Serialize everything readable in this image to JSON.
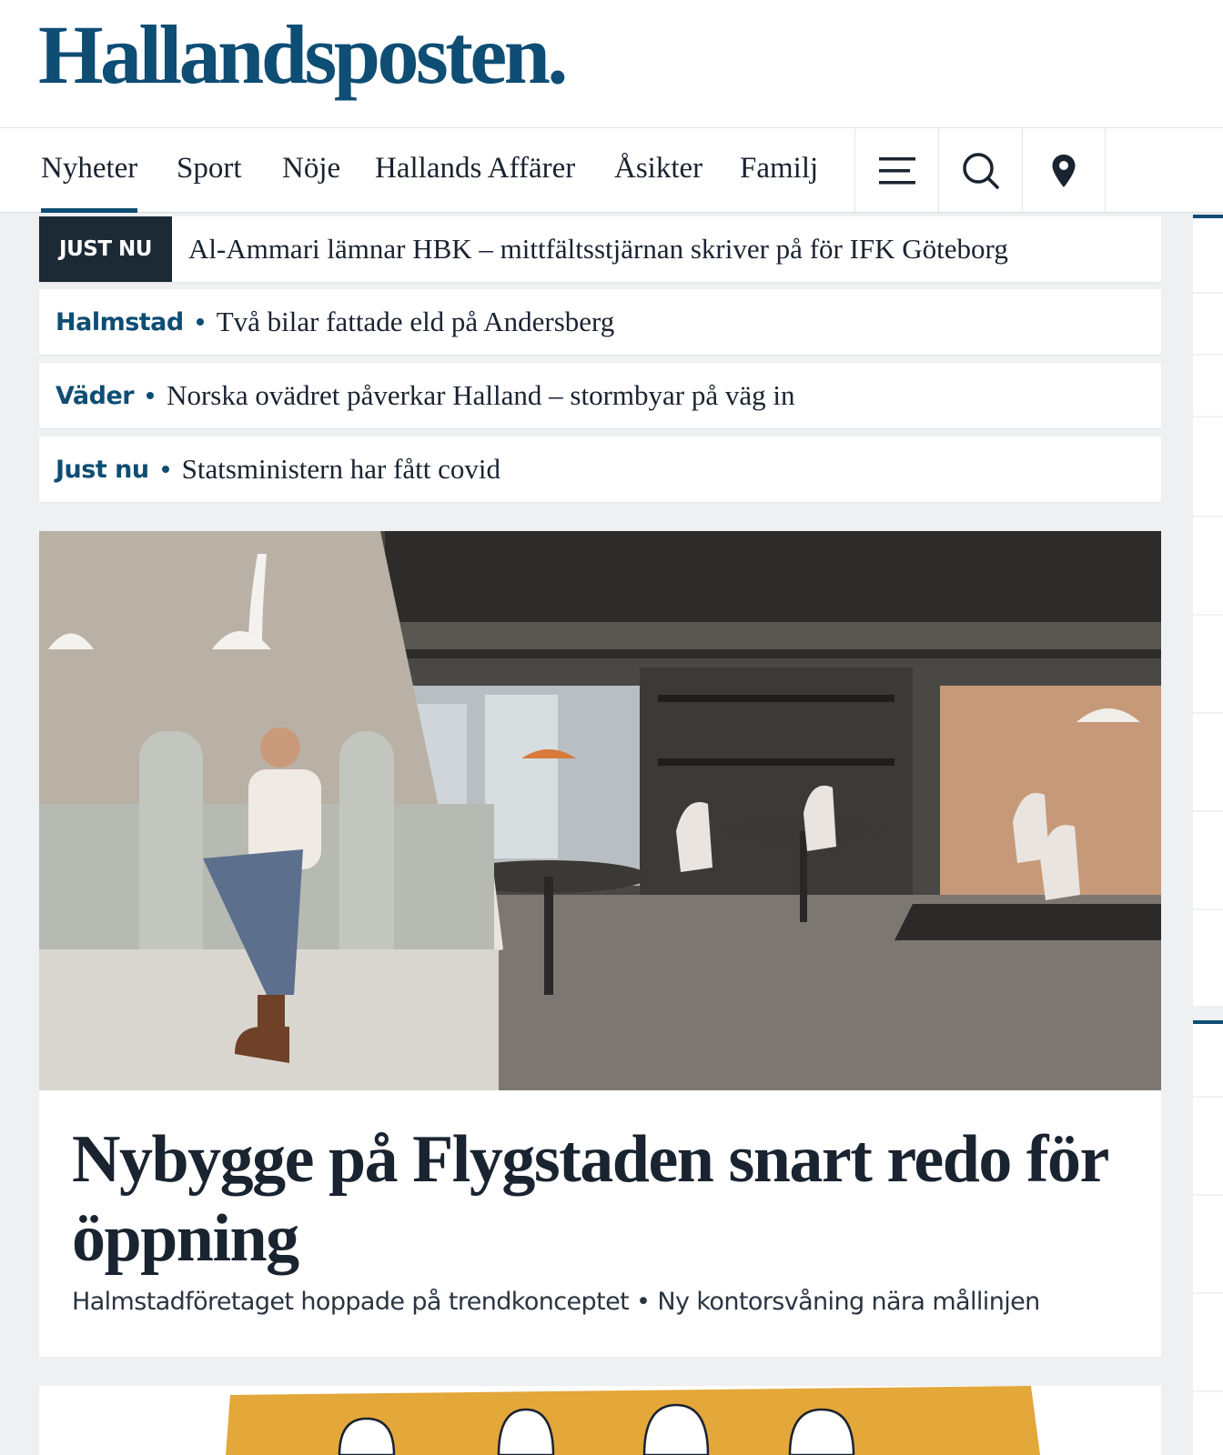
{
  "site": {
    "logo": "Hallandsposten."
  },
  "nav": {
    "items": [
      {
        "label": "Nyheter",
        "active": true
      },
      {
        "label": "Sport"
      },
      {
        "label": "Nöje"
      },
      {
        "label": "Hallands Affärer"
      },
      {
        "label": "Åsikter"
      },
      {
        "label": "Familj"
      }
    ],
    "icons": [
      "menu-icon",
      "search-icon",
      "location-pin-icon"
    ]
  },
  "breaking": {
    "badge": "JUST NU",
    "headline": "Al-Ammari lämnar HBK – mittfältsstjärnan skriver på för IFK Göteborg"
  },
  "news_items": [
    {
      "kicker": "Halmstad",
      "title": "Två bilar fattade eld på Andersberg"
    },
    {
      "kicker": "Väder",
      "title": "Norska ovädret påverkar Halland – stormbyar på väg in"
    },
    {
      "kicker": "Just nu",
      "title": "Statsministern har fått covid"
    }
  ],
  "main_article": {
    "headline": "Nybygge på Flygstaden snart redo för öppning",
    "subline": "Halmstadföretaget hoppade på trendkonceptet • Ny kontorsvåning nära mållinjen"
  },
  "colors": {
    "brand": "#0e4d74",
    "badge_bg": "#1c2a36",
    "page_bg": "#eef0f2",
    "illustration_bg": "#e3a73a"
  }
}
